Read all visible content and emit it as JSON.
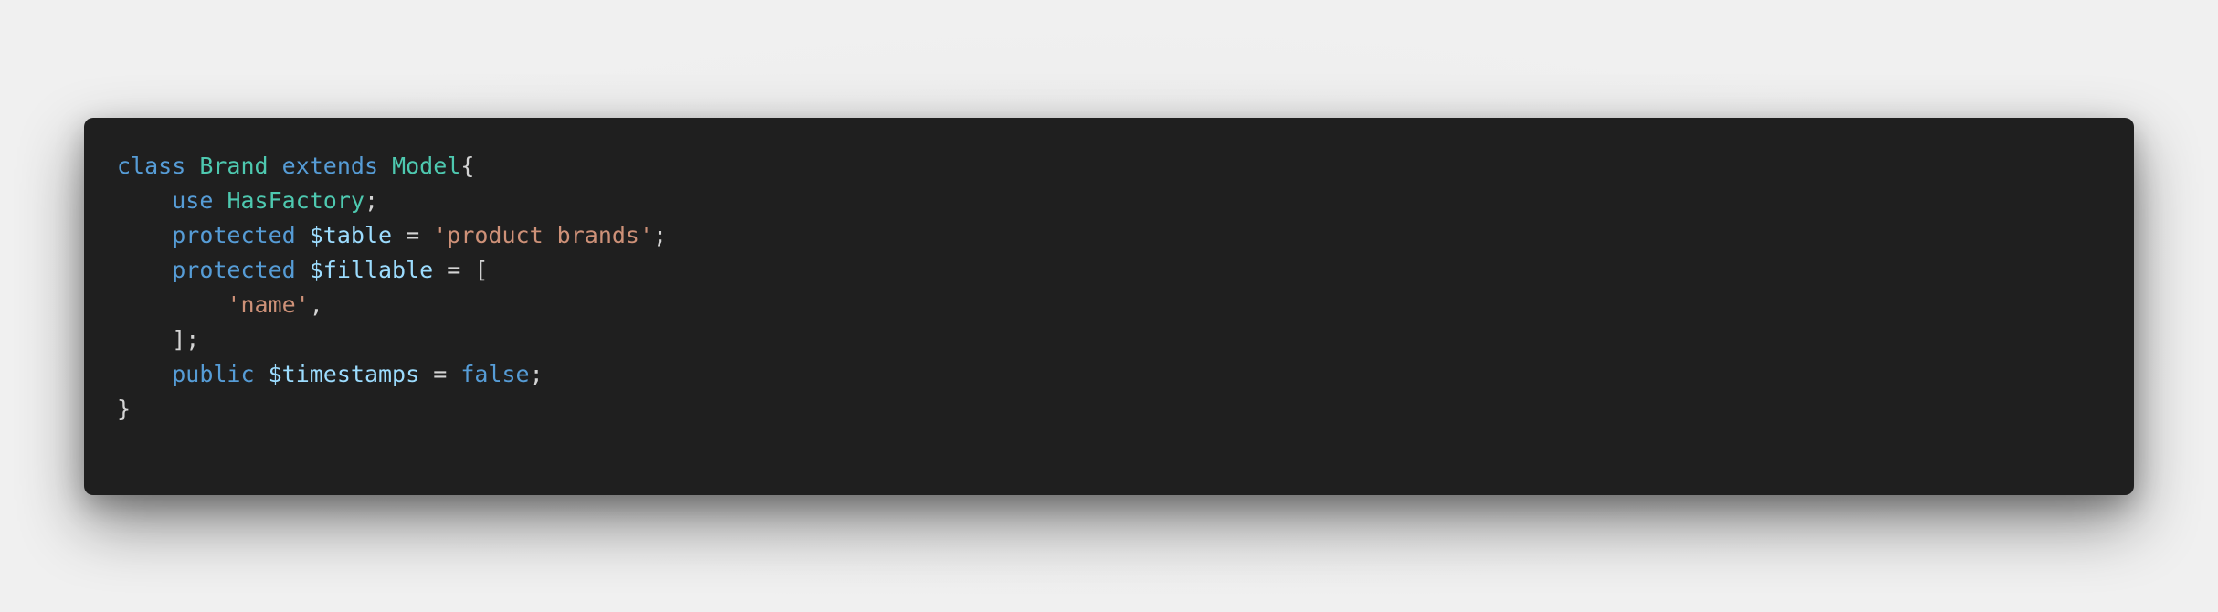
{
  "colors": {
    "background": "#f0f0f0",
    "code_background": "#1f1f1f",
    "keyword": "#569cd6",
    "type": "#4ec9b0",
    "variable": "#9cdcfe",
    "string": "#ce9178",
    "punctuation": "#d4d4d4"
  },
  "code": {
    "lines": [
      [
        {
          "t": "class",
          "k": "kw"
        },
        {
          "t": " ",
          "k": "plain"
        },
        {
          "t": "Brand",
          "k": "type"
        },
        {
          "t": " ",
          "k": "plain"
        },
        {
          "t": "extends",
          "k": "kw"
        },
        {
          "t": " ",
          "k": "plain"
        },
        {
          "t": "Model",
          "k": "type"
        },
        {
          "t": "{",
          "k": "punc"
        }
      ],
      [
        {
          "t": "    ",
          "k": "plain"
        },
        {
          "t": "use",
          "k": "kw"
        },
        {
          "t": " ",
          "k": "plain"
        },
        {
          "t": "HasFactory",
          "k": "type"
        },
        {
          "t": ";",
          "k": "punc"
        }
      ],
      [
        {
          "t": "    ",
          "k": "plain"
        },
        {
          "t": "protected",
          "k": "kw"
        },
        {
          "t": " ",
          "k": "plain"
        },
        {
          "t": "$table",
          "k": "var"
        },
        {
          "t": " = ",
          "k": "punc"
        },
        {
          "t": "'product_brands'",
          "k": "str"
        },
        {
          "t": ";",
          "k": "punc"
        }
      ],
      [
        {
          "t": "    ",
          "k": "plain"
        },
        {
          "t": "protected",
          "k": "kw"
        },
        {
          "t": " ",
          "k": "plain"
        },
        {
          "t": "$fillable",
          "k": "var"
        },
        {
          "t": " = [",
          "k": "punc"
        }
      ],
      [
        {
          "t": "        ",
          "k": "plain"
        },
        {
          "t": "'name'",
          "k": "str"
        },
        {
          "t": ",",
          "k": "punc"
        }
      ],
      [
        {
          "t": "    ",
          "k": "plain"
        },
        {
          "t": "];",
          "k": "punc"
        }
      ],
      [
        {
          "t": "    ",
          "k": "plain"
        },
        {
          "t": "public",
          "k": "kw"
        },
        {
          "t": " ",
          "k": "plain"
        },
        {
          "t": "$timestamps",
          "k": "var"
        },
        {
          "t": " = ",
          "k": "punc"
        },
        {
          "t": "false",
          "k": "kw"
        },
        {
          "t": ";",
          "k": "punc"
        }
      ],
      [
        {
          "t": "}",
          "k": "punc"
        }
      ]
    ]
  }
}
